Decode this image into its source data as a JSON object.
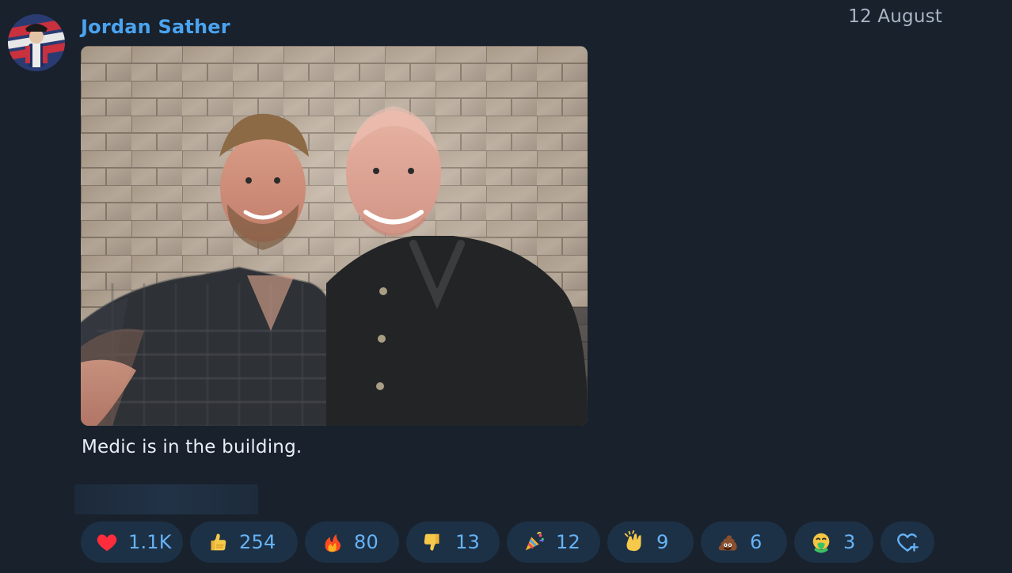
{
  "post": {
    "author": "Jordan Sather",
    "date": "12 August",
    "caption": "Medic is in the building."
  },
  "reactions": [
    {
      "emoji": "heart",
      "count": "1.1K"
    },
    {
      "emoji": "thumbs-up",
      "count": "254"
    },
    {
      "emoji": "fire",
      "count": "80"
    },
    {
      "emoji": "thumbs-down",
      "count": "13"
    },
    {
      "emoji": "party-popper",
      "count": "12"
    },
    {
      "emoji": "clapping-hands",
      "count": "9"
    },
    {
      "emoji": "pile-of-poo",
      "count": "6"
    },
    {
      "emoji": "vomiting-face",
      "count": "3"
    }
  ],
  "add_reaction": {
    "icon": "heart-plus-icon"
  },
  "colors": {
    "background": "#18212c",
    "author": "#4aa3ef",
    "reaction_bg": "#1d3146",
    "reaction_count": "#66b3f7",
    "date": "#a9b5c4",
    "caption": "#e9eef5"
  }
}
